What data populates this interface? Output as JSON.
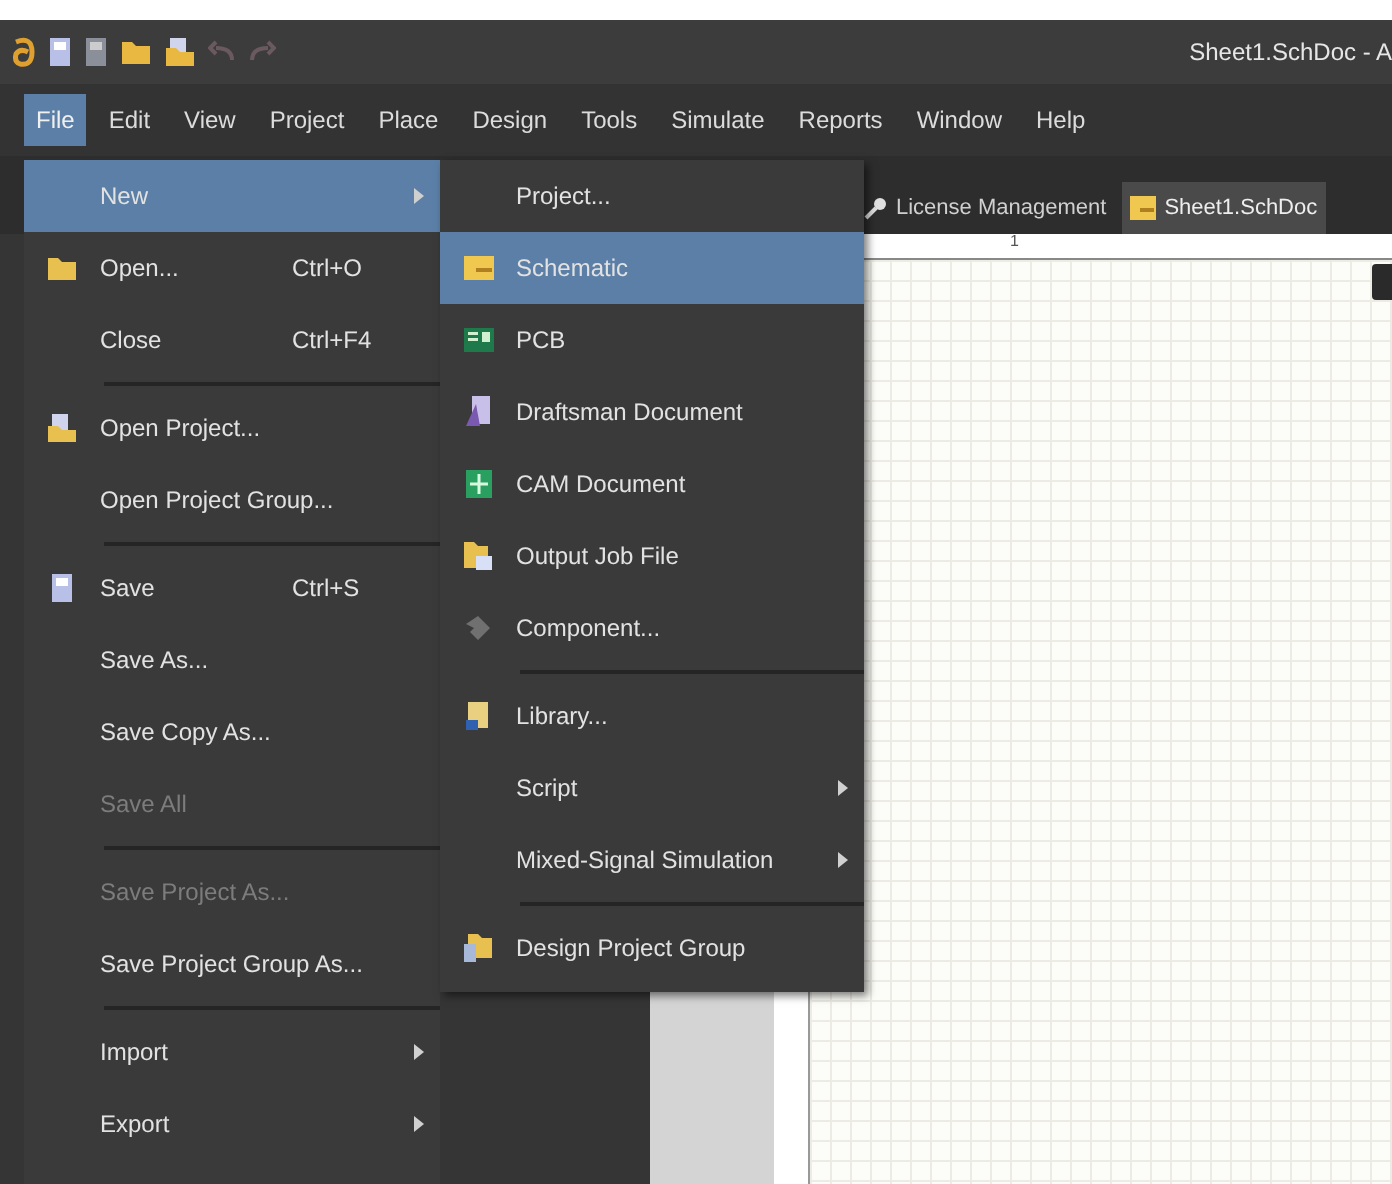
{
  "window": {
    "title": "Sheet1.SchDoc - A"
  },
  "menu_bar": [
    {
      "label": "File",
      "selected": true
    },
    {
      "label": "Edit",
      "selected": false
    },
    {
      "label": "View",
      "selected": false
    },
    {
      "label": "Project",
      "selected": false
    },
    {
      "label": "Place",
      "selected": false
    },
    {
      "label": "Design",
      "selected": false
    },
    {
      "label": "Tools",
      "selected": false
    },
    {
      "label": "Simulate",
      "selected": false
    },
    {
      "label": "Reports",
      "selected": false
    },
    {
      "label": "Window",
      "selected": false
    },
    {
      "label": "Help",
      "selected": false
    }
  ],
  "tabs": [
    {
      "label": "License Management",
      "selected": false
    },
    {
      "label": "Sheet1.SchDoc",
      "selected": true
    }
  ],
  "ruler": {
    "label": "1"
  },
  "file_menu": [
    {
      "kind": "item",
      "label": "New",
      "submenu": true,
      "selected": true,
      "disabled": false
    },
    {
      "kind": "item",
      "label": "Open...",
      "shortcut": "Ctrl+O",
      "submenu": false,
      "selected": false,
      "disabled": false
    },
    {
      "kind": "item",
      "label": "Close",
      "shortcut": "Ctrl+F4",
      "submenu": false,
      "selected": false,
      "disabled": false
    },
    {
      "kind": "separator"
    },
    {
      "kind": "item",
      "label": "Open Project...",
      "submenu": false,
      "selected": false,
      "disabled": false
    },
    {
      "kind": "item",
      "label": "Open Project Group...",
      "submenu": false,
      "selected": false,
      "disabled": false
    },
    {
      "kind": "separator"
    },
    {
      "kind": "item",
      "label": "Save",
      "shortcut": "Ctrl+S",
      "submenu": false,
      "selected": false,
      "disabled": false
    },
    {
      "kind": "item",
      "label": "Save As...",
      "submenu": false,
      "selected": false,
      "disabled": false
    },
    {
      "kind": "item",
      "label": "Save Copy As...",
      "submenu": false,
      "selected": false,
      "disabled": false
    },
    {
      "kind": "item",
      "label": "Save All",
      "submenu": false,
      "selected": false,
      "disabled": true
    },
    {
      "kind": "separator"
    },
    {
      "kind": "item",
      "label": "Save Project As...",
      "submenu": false,
      "selected": false,
      "disabled": true
    },
    {
      "kind": "item",
      "label": "Save Project Group As...",
      "submenu": false,
      "selected": false,
      "disabled": false
    },
    {
      "kind": "separator"
    },
    {
      "kind": "item",
      "label": "Import",
      "submenu": true,
      "selected": false,
      "disabled": false
    },
    {
      "kind": "item",
      "label": "Export",
      "submenu": true,
      "selected": false,
      "disabled": false
    }
  ],
  "new_submenu": [
    {
      "kind": "item",
      "label": "Project...",
      "submenu": false,
      "selected": false
    },
    {
      "kind": "item",
      "label": "Schematic",
      "submenu": false,
      "selected": true
    },
    {
      "kind": "item",
      "label": "PCB",
      "submenu": false,
      "selected": false
    },
    {
      "kind": "item",
      "label": "Draftsman Document",
      "submenu": false,
      "selected": false
    },
    {
      "kind": "item",
      "label": "CAM Document",
      "submenu": false,
      "selected": false
    },
    {
      "kind": "item",
      "label": "Output Job File",
      "submenu": false,
      "selected": false
    },
    {
      "kind": "item",
      "label": "Component...",
      "submenu": false,
      "selected": false
    },
    {
      "kind": "separator"
    },
    {
      "kind": "item",
      "label": "Library...",
      "submenu": false,
      "selected": false
    },
    {
      "kind": "item",
      "label": "Script",
      "submenu": true,
      "selected": false
    },
    {
      "kind": "item",
      "label": "Mixed-Signal Simulation",
      "submenu": true,
      "selected": false
    },
    {
      "kind": "separator"
    },
    {
      "kind": "item",
      "label": "Design Project Group",
      "submenu": false,
      "selected": false
    }
  ]
}
